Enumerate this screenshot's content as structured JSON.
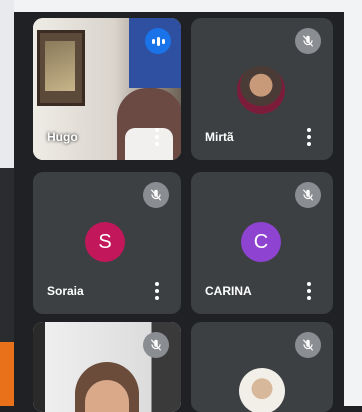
{
  "participants": [
    {
      "name": "Hugo",
      "tile": "video",
      "muted": false,
      "speaking": true
    },
    {
      "name": "Mirtã",
      "tile": "photo-avatar",
      "muted": true
    },
    {
      "name": "Soraia",
      "tile": "initial-avatar",
      "initial": "S",
      "avatar_color": "#c2185b",
      "muted": true
    },
    {
      "name": "CARINA",
      "tile": "initial-avatar",
      "initial": "C",
      "avatar_color": "#8e44d0",
      "muted": true
    },
    {
      "name": "",
      "tile": "video",
      "muted": true
    },
    {
      "name": "",
      "tile": "photo-avatar",
      "muted": true
    }
  ],
  "colors": {
    "background": "#202124",
    "tile": "#3c4043",
    "accent_speaking": "#1a73e8"
  },
  "icons": {
    "muted": "mic-off-icon",
    "more": "more-vert-icon",
    "speaking": "audio-level-icon"
  }
}
